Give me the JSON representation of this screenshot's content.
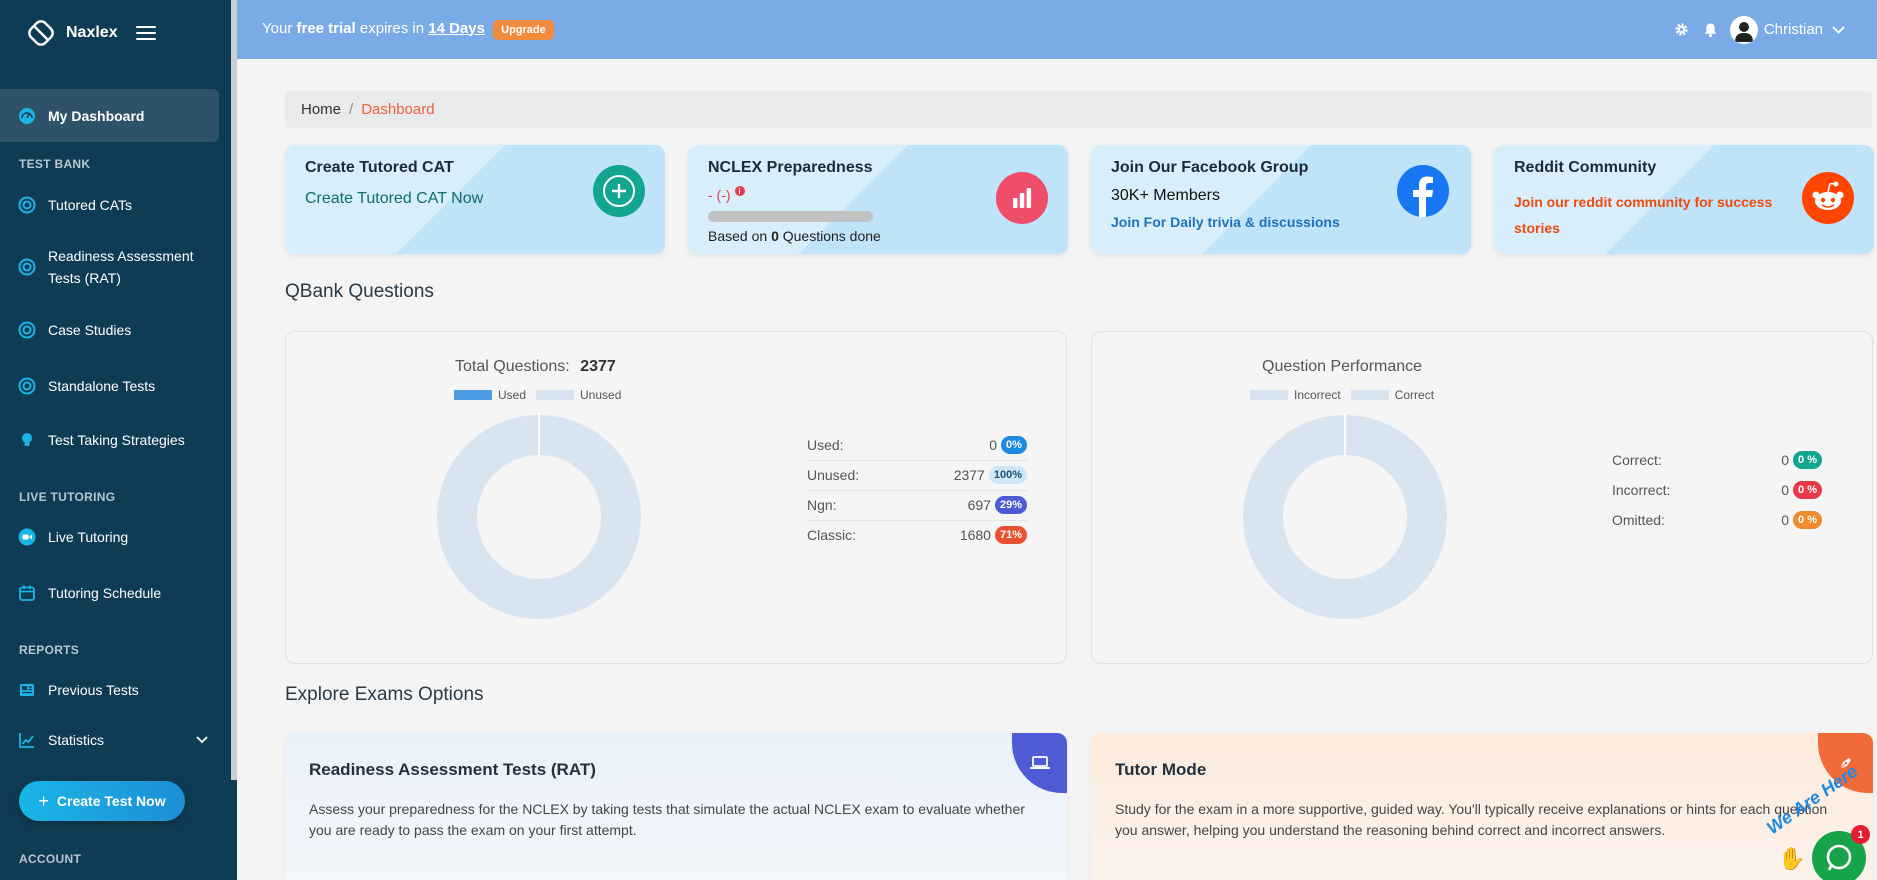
{
  "app": {
    "name": "Naxlex"
  },
  "sidebar": {
    "active": "My Dashboard",
    "sections": {
      "test_bank": "TEST BANK",
      "live_tutoring": "LIVE TUTORING",
      "reports": "REPORTS",
      "account": "ACCOUNT"
    },
    "items": [
      {
        "label": "My Dashboard",
        "icon": "dashboard-icon"
      },
      {
        "label": "Tutored CATs",
        "icon": "target-icon"
      },
      {
        "label": "Readiness Assessment Tests (RAT)",
        "icon": "target-icon"
      },
      {
        "label": "Case Studies",
        "icon": "target-icon"
      },
      {
        "label": "Standalone Tests",
        "icon": "target-icon"
      },
      {
        "label": "Test Taking Strategies",
        "icon": "lightbulb-icon"
      },
      {
        "label": "Live Tutoring",
        "icon": "video-icon"
      },
      {
        "label": "Tutoring Schedule",
        "icon": "calendar-icon"
      },
      {
        "label": "Previous Tests",
        "icon": "newspaper-icon"
      },
      {
        "label": "Statistics",
        "icon": "chart-icon"
      }
    ],
    "create_button": "Create Test Now"
  },
  "topbar": {
    "trial_prefix": "Your",
    "trial_bold": "free trial",
    "trial_middle": "expires in",
    "trial_days": "14 Days",
    "upgrade_label": "Upgrade",
    "user_name": "Christian"
  },
  "breadcrumb": {
    "home": "Home",
    "separator": "/",
    "current": "Dashboard"
  },
  "cards": {
    "tutored_cat": {
      "title": "Create Tutored CAT",
      "link": "Create Tutored CAT Now"
    },
    "nclex": {
      "title": "NCLEX Preparedness",
      "score": "- (-)",
      "based_prefix": "Based on",
      "based_count": "0",
      "based_suffix": "Questions done",
      "progress": 0
    },
    "facebook": {
      "title": "Join Our Facebook Group",
      "members": "30K+ Members",
      "link": "Join For Daily trivia & discussions"
    },
    "reddit": {
      "title": "Reddit Community",
      "link_line1": "Join our reddit community for success",
      "link_line2": "stories"
    }
  },
  "qbank": {
    "section_title": "QBank Questions",
    "total_label": "Total Questions:",
    "total_value": "2377",
    "legend": [
      "Used",
      "Unused"
    ],
    "stats": [
      {
        "label": "Used:",
        "value": "0",
        "pct": "0%",
        "color": "#1e88e5"
      },
      {
        "label": "Unused:",
        "value": "2377",
        "pct": "100%",
        "color": "#cfe6f7"
      },
      {
        "label": "Ngn:",
        "value": "697",
        "pct": "29%",
        "color": "#4f5bd5"
      },
      {
        "label": "Classic:",
        "value": "1680",
        "pct": "71%",
        "color": "#e8512f"
      }
    ]
  },
  "performance": {
    "title": "Question Performance",
    "legend": [
      "Incorrect",
      "Correct"
    ],
    "stats": [
      {
        "label": "Correct:",
        "value": "0",
        "pct": "0 %",
        "color": "#12a58f"
      },
      {
        "label": "Incorrect:",
        "value": "0",
        "pct": "0 %",
        "color": "#e6394a"
      },
      {
        "label": "Omitted:",
        "value": "0",
        "pct": "0 %",
        "color": "#f08a2c"
      }
    ]
  },
  "explore": {
    "section_title": "Explore Exams Options",
    "rat": {
      "title": "Readiness Assessment Tests (RAT)",
      "desc": "Assess your preparedness for the NCLEX by taking tests that simulate the actual NCLEX exam to evaluate whether you are ready to pass the exam on your first attempt."
    },
    "tutor": {
      "title": "Tutor Mode",
      "desc": "Study for the exam in a more supportive, guided way. You'll typically receive explanations or hints for each question you answer, helping you understand the reasoning behind correct and incorrect answers."
    }
  },
  "chat": {
    "badge": "1",
    "tagline": "We Are Here"
  },
  "colors": {
    "sidebar": "#0f3c55",
    "topbar": "#7aabe6",
    "accent": "#e8643a"
  }
}
